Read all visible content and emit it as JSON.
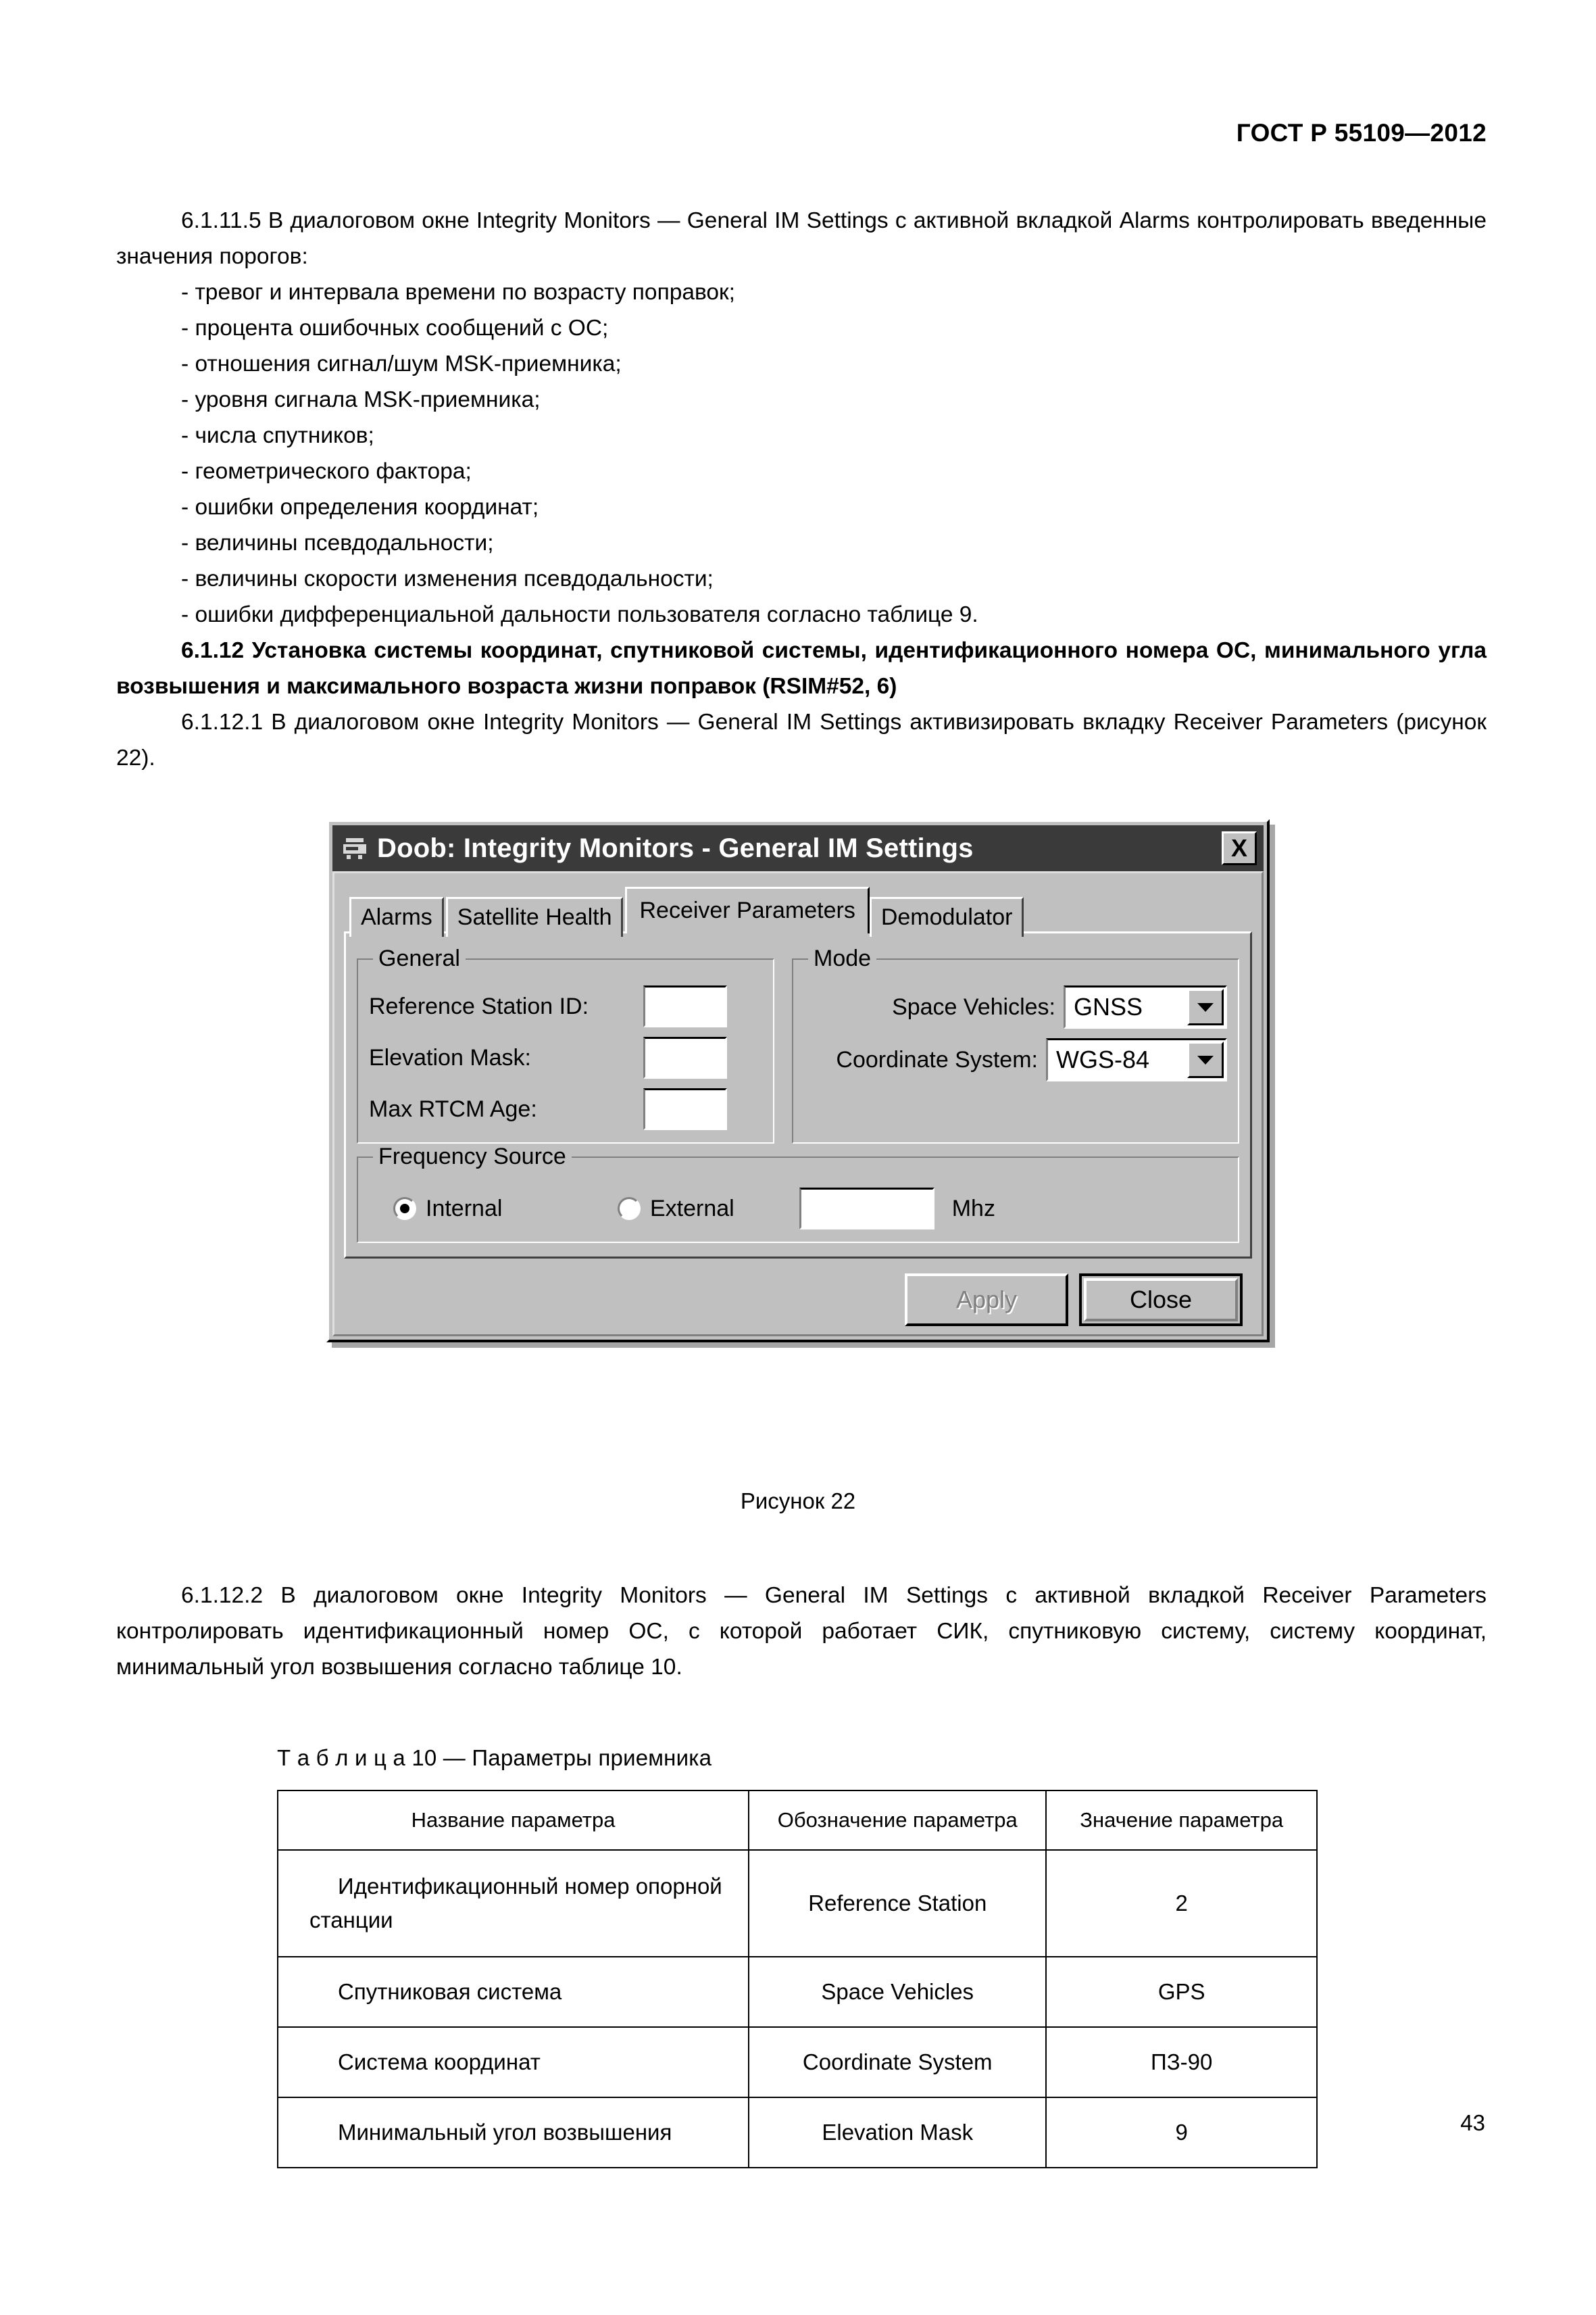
{
  "document": {
    "header": "ГОСТ Р 55109—2012",
    "page_number": "43"
  },
  "body": {
    "para_6_1_11_5": "6.1.11.5 В диалоговом окне Integrity Monitors — General IM Settings с активной вкладкой Alarms контролировать введенные значения порогов:",
    "bullets": [
      "- тревог и интервала времени по возрасту поправок;",
      "- процента ошибочных сообщений с ОС;",
      "- отношения сигнал/шум MSK-приемника;",
      "- уровня сигнала MSK-приемника;",
      "- числа спутников;",
      "- геометрического фактора;",
      "- ошибки определения координат;",
      "- величины псевдодальности;",
      "- величины скорости изменения псевдодальности;",
      "- ошибки дифференциальной дальности пользователя согласно таблице 9."
    ],
    "para_6_1_12": "6.1.12 Установка системы координат, спутниковой системы, идентификационного номера ОС, минимального угла возвышения и максимального возраста жизни поправок (RSIM#52, 6)",
    "para_6_1_12_1": "6.1.12.1 В диалоговом окне Integrity Monitors — General IM Settings активизировать вкладку Receiver Parameters (рисунок 22).",
    "para_6_1_12_2": "6.1.12.2 В диалоговом окне Integrity Monitors — General IM Settings с активной вкладкой Receiver Parameters контролировать идентификационный номер ОС, с которой работает СИК, спутниковую систему, систему координат, минимальный угол возвышения согласно таблице 10."
  },
  "figure": {
    "caption": "Рисунок 22",
    "dialog": {
      "title": "Doob: Integrity Monitors - General IM Settings",
      "close_label": "X",
      "tabs": [
        {
          "label": "Alarms",
          "active": false
        },
        {
          "label": "Satellite Health",
          "active": false
        },
        {
          "label": "Receiver Parameters",
          "active": true
        },
        {
          "label": "Demodulator",
          "active": false
        }
      ],
      "general_group": {
        "legend": "General",
        "fields": [
          {
            "label": "Reference Station ID:",
            "value": ""
          },
          {
            "label": "Elevation Mask:",
            "value": ""
          },
          {
            "label": "Max RTCM Age:",
            "value": ""
          }
        ]
      },
      "mode_group": {
        "legend": "Mode",
        "space_vehicles_label": "Space Vehicles:",
        "space_vehicles_value": "GNSS",
        "coordinate_system_label": "Coordinate System:",
        "coordinate_system_value": "WGS-84"
      },
      "frequency_group": {
        "legend": "Frequency Source",
        "internal_label": "Internal",
        "external_label": "External",
        "internal_selected": true,
        "frequency_value": "",
        "unit_label": "Mhz"
      },
      "buttons": {
        "apply_label": "Apply",
        "apply_enabled": false,
        "close_label": "Close"
      }
    }
  },
  "table": {
    "caption": "Т а б л и ц а  10 — Параметры приемника",
    "headers": [
      "Название параметра",
      "Обозначение параметра",
      "Значение параметра"
    ],
    "rows": [
      {
        "name": "Идентификационный номер опорной станции",
        "code": "Reference Station",
        "value": "2"
      },
      {
        "name": "Спутниковая система",
        "code": "Space Vehicles",
        "value": "GPS"
      },
      {
        "name": "Система координат",
        "code": "Coordinate System",
        "value": "ПЗ-90"
      },
      {
        "name": "Минимальный угол возвышения",
        "code": "Elevation Mask",
        "value": "9"
      }
    ]
  }
}
